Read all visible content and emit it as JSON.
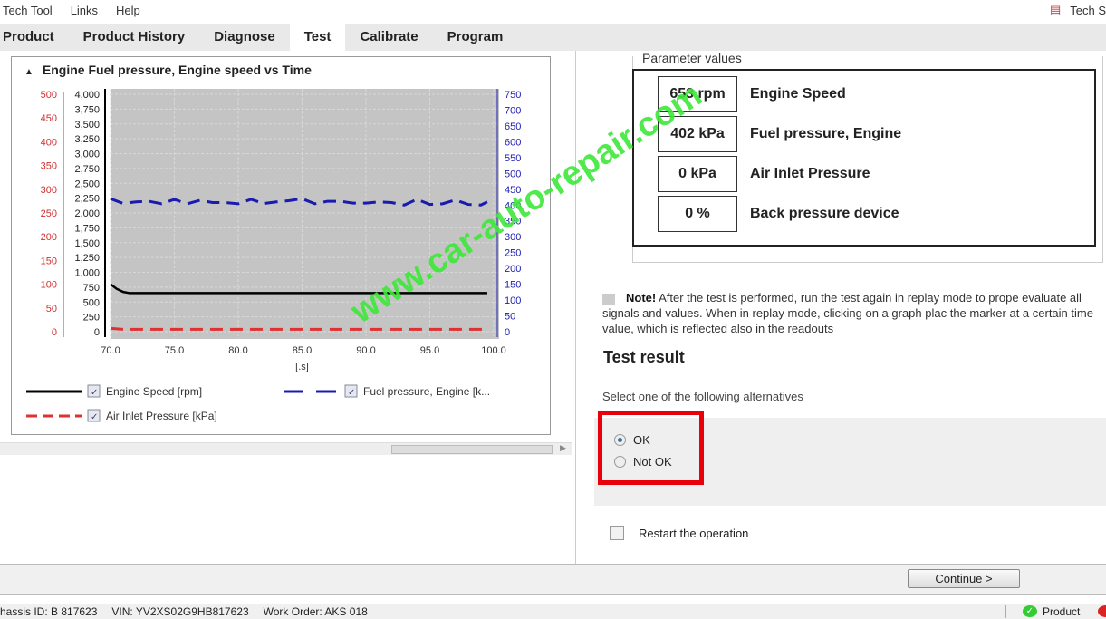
{
  "menu": {
    "items": [
      "Tech Tool",
      "Links",
      "Help"
    ],
    "right_label": "Tech S"
  },
  "tabs": [
    {
      "label": "Product"
    },
    {
      "label": "Product History"
    },
    {
      "label": "Diagnose"
    },
    {
      "label": "Test",
      "active": true
    },
    {
      "label": "Calibrate"
    },
    {
      "label": "Program"
    }
  ],
  "chart_data": {
    "type": "line",
    "title": "Engine Fuel pressure, Engine speed vs Time",
    "xlabel": "[.s]",
    "xlim": [
      70,
      100
    ],
    "x_ticks": [
      "70.0",
      "75.0",
      "80.0",
      "85.0",
      "90.0",
      "95.0",
      "100.0"
    ],
    "axes": {
      "rpm": {
        "range": [
          0,
          4000
        ],
        "ticks": [
          "0",
          "250",
          "500",
          "750",
          "1,000",
          "1,250",
          "1,500",
          "1,750",
          "2,000",
          "2,250",
          "2,500",
          "2,750",
          "3,000",
          "3,250",
          "3,500",
          "3,750",
          "4,000"
        ],
        "color": "#000000"
      },
      "air": {
        "range": [
          0,
          500
        ],
        "ticks": [
          "0",
          "50",
          "100",
          "150",
          "200",
          "250",
          "300",
          "350",
          "400",
          "450",
          "500"
        ],
        "color": "#d03030"
      },
      "fuel": {
        "range": [
          0,
          750
        ],
        "ticks": [
          "0",
          "50",
          "100",
          "150",
          "200",
          "250",
          "300",
          "350",
          "400",
          "450",
          "500",
          "550",
          "600",
          "650",
          "700",
          "750"
        ],
        "color": "#2020b0"
      }
    },
    "grid": true,
    "series": [
      {
        "name": "Engine Speed [rpm]",
        "axis": "rpm",
        "color": "#000000",
        "style": "solid",
        "x": [
          70,
          70.5,
          71,
          71.5,
          72,
          80,
          90,
          99.5
        ],
        "y": [
          800,
          720,
          670,
          650,
          650,
          650,
          650,
          650
        ]
      },
      {
        "name": "Fuel pressure, Engine [k...",
        "axis": "fuel",
        "color": "#1a1ab0",
        "style": "dashed",
        "x": [
          70,
          71,
          72,
          73,
          74,
          75,
          76,
          77,
          78,
          79,
          80,
          81,
          82,
          83,
          84,
          85,
          86,
          87,
          88,
          89,
          90,
          91,
          92,
          93,
          94,
          95,
          96,
          97,
          98,
          99,
          99.5
        ],
        "y": [
          420,
          405,
          410,
          412,
          404,
          418,
          404,
          415,
          408,
          408,
          404,
          418,
          405,
          410,
          414,
          420,
          404,
          412,
          412,
          406,
          406,
          410,
          408,
          400,
          418,
          402,
          404,
          416,
          402,
          400,
          410
        ]
      },
      {
        "name": "Air Inlet Pressure [kPa]",
        "axis": "air",
        "color": "#e03030",
        "style": "dashed",
        "x": [
          70,
          71,
          75,
          80,
          90,
          99.5
        ],
        "y": [
          7,
          5,
          5,
          5,
          5,
          5
        ]
      }
    ],
    "legend": "bottom"
  },
  "params": {
    "group_label": "Parameter values",
    "rows": [
      {
        "value": "653 rpm",
        "label": "Engine Speed"
      },
      {
        "value": "402 kPa",
        "label": "Fuel pressure, Engine"
      },
      {
        "value": "0 kPa",
        "label": "Air Inlet Pressure"
      },
      {
        "value": "0 %",
        "label": "Back pressure device"
      }
    ]
  },
  "note": {
    "bold": "Note!",
    "text": " After the test is performed, run the test again in replay mode to prope evaluate all signals and values. When in replay mode, clicking on a graph plac the marker at a certain time value, which is reflected also in the readouts"
  },
  "test_result": {
    "heading": "Test result",
    "prompt": "Select one of the following alternatives",
    "options": [
      "OK",
      "Not OK"
    ],
    "selected": "OK",
    "restart_label": "Restart the operation"
  },
  "continue_label": "Continue >",
  "status": {
    "chassis": "hassis ID: B 817623",
    "vin": "VIN: YV2XS02G9HB817623",
    "work_order": "Work Order: AKS 018",
    "product": "Product"
  },
  "watermark": "www.car-auto-repair.com"
}
